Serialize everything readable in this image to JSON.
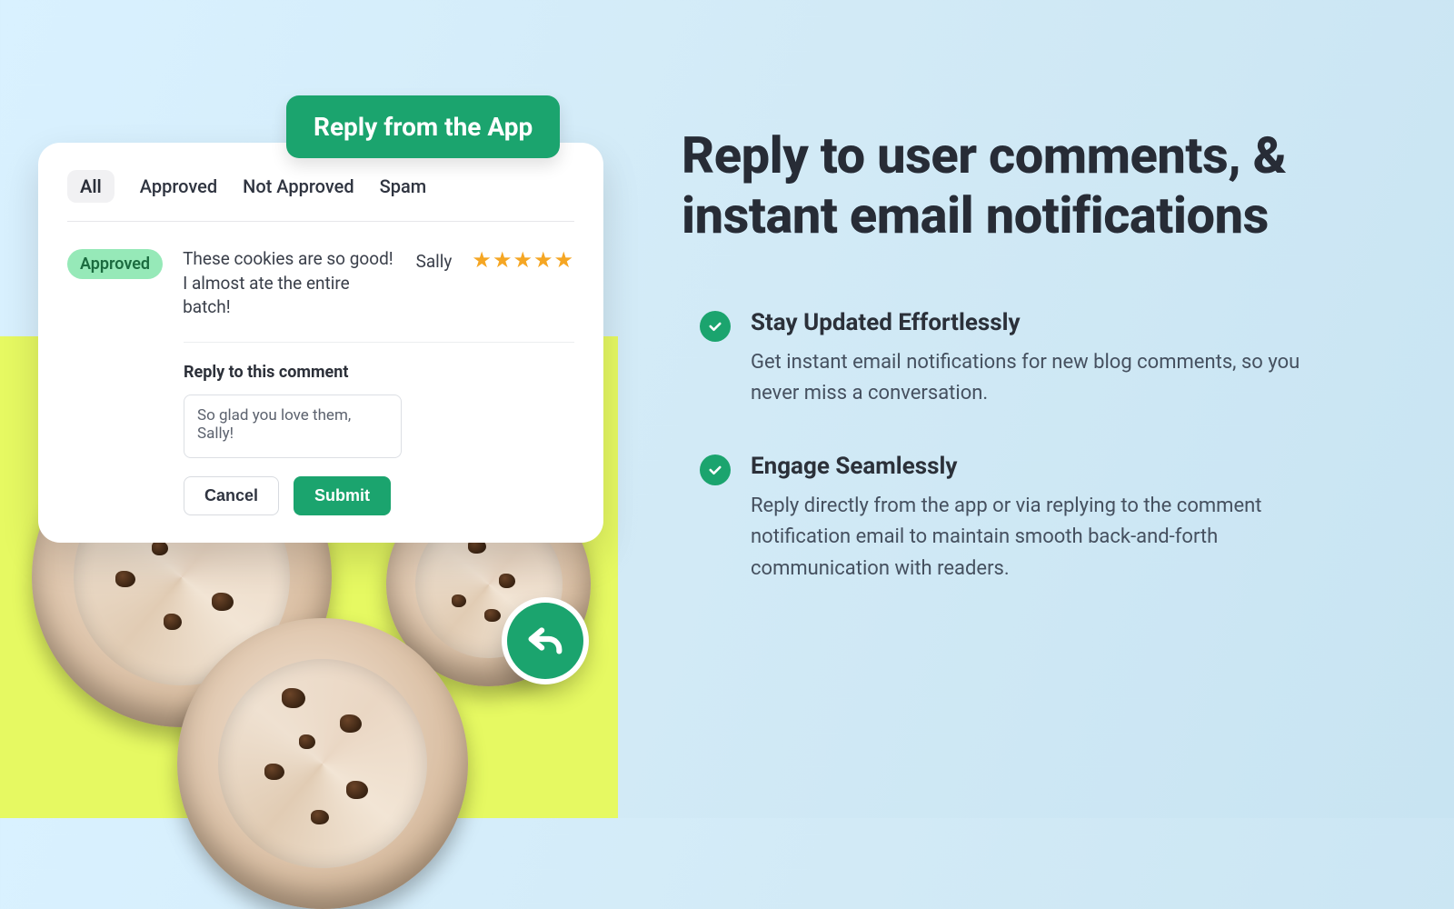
{
  "badge": {
    "label": "Reply from the App"
  },
  "tabs": [
    "All",
    "Approved",
    "Not Approved",
    "Spam"
  ],
  "comment": {
    "status": "Approved",
    "text": "These cookies are so good! I almost ate the entire batch!",
    "author": "Sally",
    "rating_stars": "★★★★★"
  },
  "reply": {
    "label": "Reply to this comment",
    "draft": "So glad you love them, Sally!",
    "cancel": "Cancel",
    "submit": "Submit"
  },
  "headline": "Reply to user comments, & instant email notifications",
  "features": [
    {
      "title": "Stay Updated Effortlessly",
      "desc": "Get instant email notifications for new blog comments, so you never miss a conversation."
    },
    {
      "title": "Engage Seamlessly",
      "desc": "Reply directly from the app or via replying to the comment notification email to maintain smooth back-and-forth communication with readers."
    }
  ]
}
